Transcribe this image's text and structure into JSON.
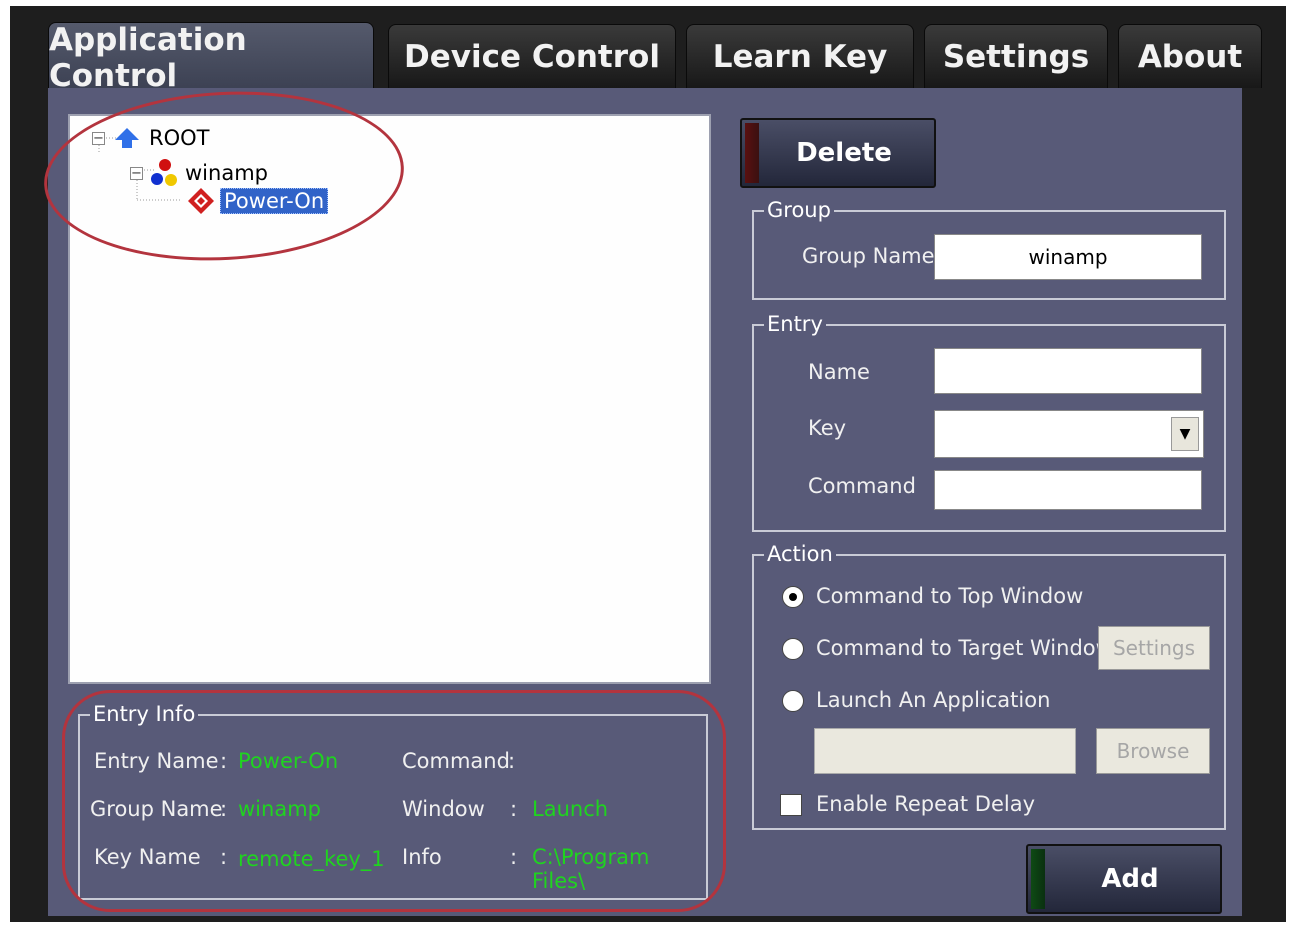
{
  "tabs": [
    {
      "label": "Application Control"
    },
    {
      "label": "Device Control"
    },
    {
      "label": "Learn Key"
    },
    {
      "label": "Settings"
    },
    {
      "label": "About"
    }
  ],
  "tree": {
    "root": {
      "label": "ROOT",
      "expander": "−"
    },
    "group": {
      "label": "winamp",
      "expander": "−"
    },
    "entry": {
      "label": "Power-On"
    }
  },
  "entry_info": {
    "title": "Entry Info",
    "entry_name_label": "Entry Name",
    "entry_name_colon": ":",
    "entry_name_value": "Power-On",
    "group_name_label": "Group Name",
    "group_name_colon": ":",
    "group_name_value": "winamp",
    "key_name_label": "Key Name",
    "key_name_colon": ":",
    "key_name_value": "remote_key_1",
    "command_label": "Command",
    "command_colon": ":",
    "window_label": "Window",
    "window_colon": ":",
    "window_value": "Launch",
    "info_label": "Info",
    "info_colon": ":",
    "info_value": "C:\\Program Files\\"
  },
  "delete_button": "Delete",
  "group": {
    "title": "Group",
    "name_label": "Group Name",
    "name_value": "winamp"
  },
  "entry": {
    "title": "Entry",
    "name_label": "Name",
    "key_label": "Key",
    "command_label": "Command",
    "dropdown_arrow": "▼"
  },
  "action": {
    "title": "Action",
    "option_top": "Command to Top Window",
    "option_target": "Command to Target Window",
    "option_launch": "Launch An Application",
    "settings_button": "Settings",
    "browse_button": "Browse",
    "repeat_delay": "Enable Repeat Delay",
    "selected": "Command to Top Window"
  },
  "add_button": "Add",
  "colors": {
    "panel": "#585a78",
    "value_text": "#1fd41f",
    "annotation": "#b3343e"
  }
}
